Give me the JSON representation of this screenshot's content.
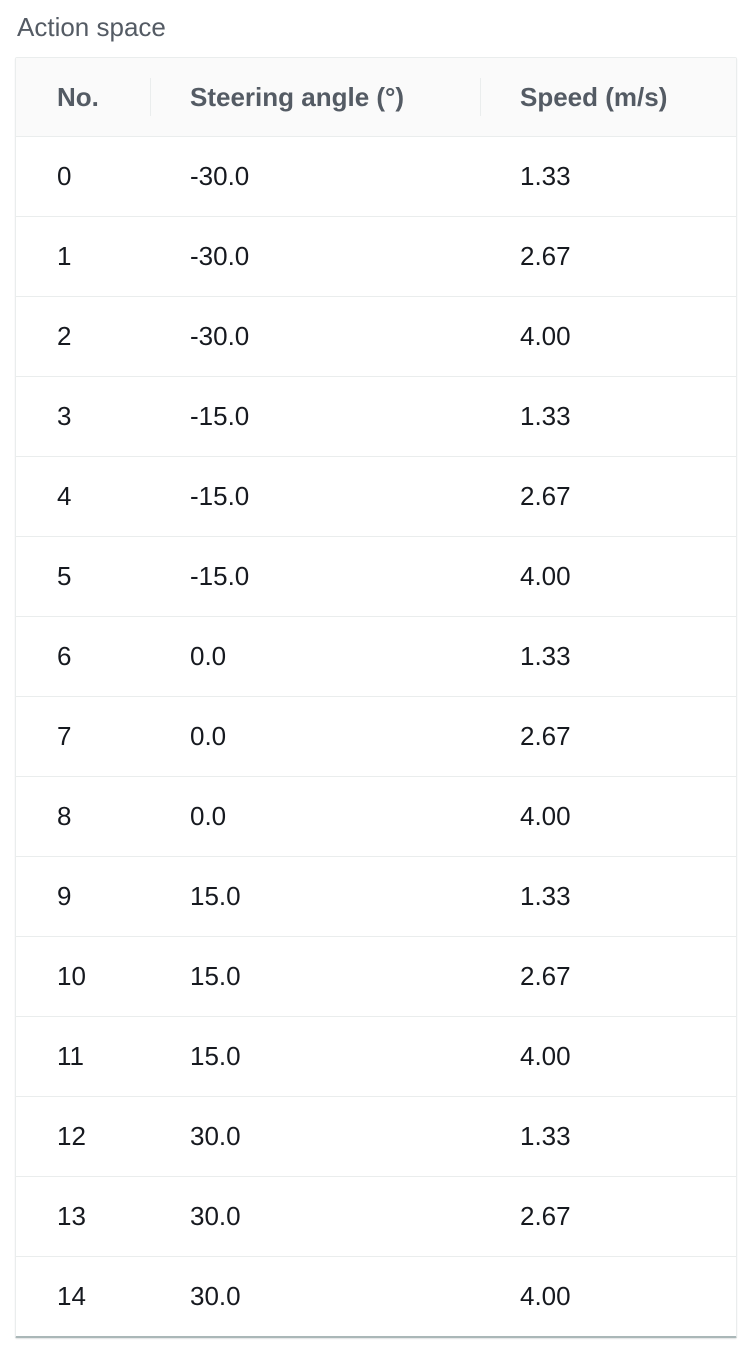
{
  "section": {
    "title": "Action space"
  },
  "table": {
    "headers": [
      "No.",
      "Steering angle (°)",
      "Speed (m/s)"
    ],
    "rows": [
      [
        "0",
        "-30.0",
        "1.33"
      ],
      [
        "1",
        "-30.0",
        "2.67"
      ],
      [
        "2",
        "-30.0",
        "4.00"
      ],
      [
        "3",
        "-15.0",
        "1.33"
      ],
      [
        "4",
        "-15.0",
        "2.67"
      ],
      [
        "5",
        "-15.0",
        "4.00"
      ],
      [
        "6",
        "0.0",
        "1.33"
      ],
      [
        "7",
        "0.0",
        "2.67"
      ],
      [
        "8",
        "0.0",
        "4.00"
      ],
      [
        "9",
        "15.0",
        "1.33"
      ],
      [
        "10",
        "15.0",
        "2.67"
      ],
      [
        "11",
        "15.0",
        "4.00"
      ],
      [
        "12",
        "30.0",
        "1.33"
      ],
      [
        "13",
        "30.0",
        "2.67"
      ],
      [
        "14",
        "30.0",
        "4.00"
      ]
    ]
  },
  "colors": {
    "text": "#16191f",
    "header_text": "#545b64",
    "header_bg": "#fafafa",
    "row_divider": "#eaeded",
    "bottom_border": "#aab7b8"
  }
}
